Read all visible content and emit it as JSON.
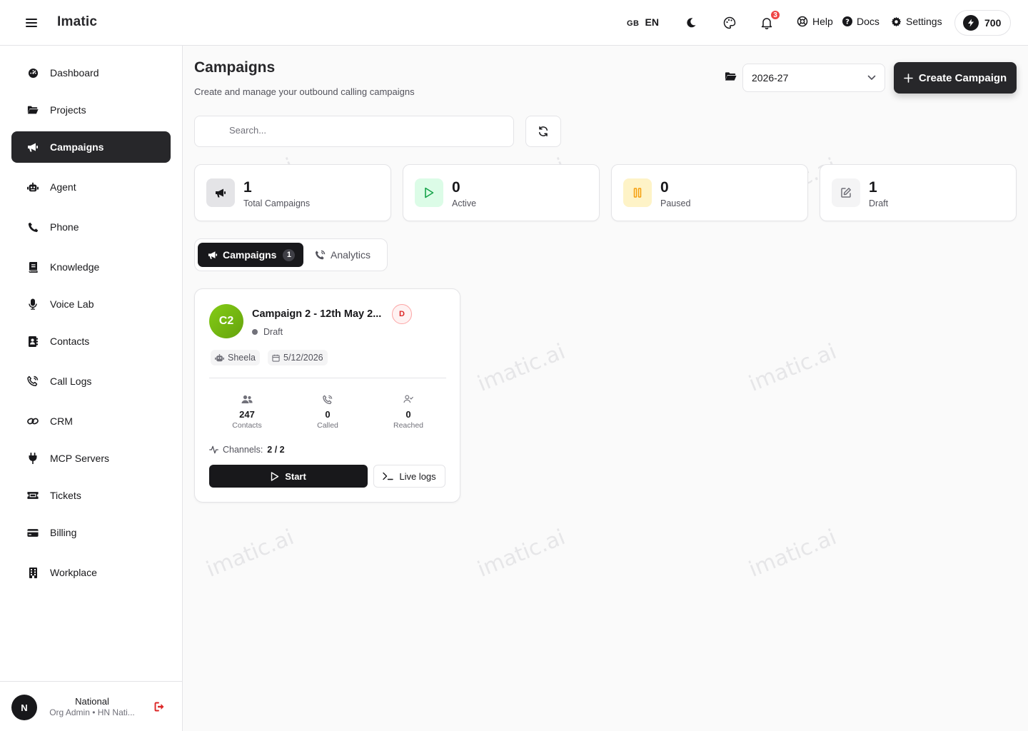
{
  "header": {
    "brand": "Imatic",
    "flag": "GB",
    "language": "EN",
    "notification_count": "3",
    "help_label": "Help",
    "docs_label": "Docs",
    "settings_label": "Settings",
    "credits": "700"
  },
  "sidebar": {
    "items": [
      {
        "label": "Dashboard",
        "icon": "dashboard-icon"
      },
      {
        "label": "Projects",
        "icon": "folder-icon"
      },
      {
        "label": "Campaigns",
        "icon": "megaphone-icon",
        "active": true
      },
      {
        "label": "Agent",
        "icon": "robot-icon"
      },
      {
        "label": "Phone",
        "icon": "phone-icon"
      },
      {
        "label": "Knowledge",
        "icon": "book-icon"
      },
      {
        "label": "Voice Lab",
        "icon": "microphone-icon"
      },
      {
        "label": "Contacts",
        "icon": "address-book-icon"
      },
      {
        "label": "Call Logs",
        "icon": "phone-volume-icon"
      },
      {
        "label": "CRM",
        "icon": "link-icon"
      },
      {
        "label": "MCP Servers",
        "icon": "plug-icon"
      },
      {
        "label": "Tickets",
        "icon": "ticket-icon"
      },
      {
        "label": "Billing",
        "icon": "credit-card-icon"
      },
      {
        "label": "Workplace",
        "icon": "building-icon"
      }
    ],
    "user": {
      "initial": "N",
      "name": "National",
      "role": "Org Admin • HN Nati..."
    }
  },
  "main": {
    "title": "Campaigns",
    "subtitle": "Create and manage your outbound calling campaigns",
    "year_selected": "2026-27",
    "create_label": "Create Campaign",
    "search_placeholder": "Search..."
  },
  "stats": [
    {
      "value": "1",
      "label": "Total Campaigns",
      "icon": "megaphone-icon"
    },
    {
      "value": "0",
      "label": "Active",
      "icon": "play-icon",
      "color": "#16a34a"
    },
    {
      "value": "0",
      "label": "Paused",
      "icon": "pause-icon",
      "color": "#f59e0b"
    },
    {
      "value": "1",
      "label": "Draft",
      "icon": "edit-icon"
    }
  ],
  "tabs": {
    "campaigns_label": "Campaigns",
    "campaigns_count": "1",
    "analytics_label": "Analytics"
  },
  "campaign_card": {
    "initials": "C2",
    "name": "Campaign 2 - 12th May 2...",
    "status": "Draft",
    "badge": "D",
    "agent": "Sheela",
    "date": "5/12/2026",
    "metrics": [
      {
        "value": "247",
        "label": "Contacts"
      },
      {
        "value": "0",
        "label": "Called"
      },
      {
        "value": "0",
        "label": "Reached"
      }
    ],
    "channels_label": "Channels:",
    "channels_value": "2 / 2",
    "start_label": "Start",
    "logs_label": "Live logs"
  },
  "watermark": "imatic.ai",
  "colors": {
    "primary": "#27272a",
    "active_green": "#16a34a",
    "paused_amber": "#f59e0b",
    "danger": "#ef4444",
    "avatar_green": "#84cc16"
  }
}
